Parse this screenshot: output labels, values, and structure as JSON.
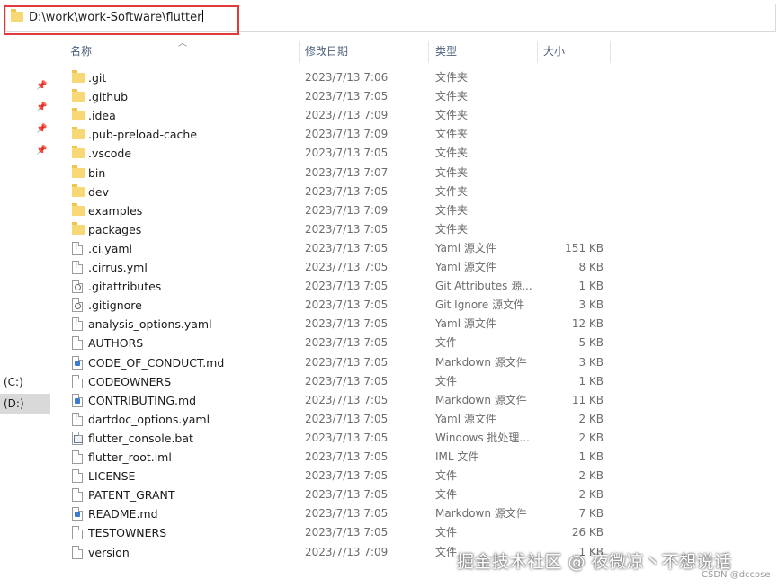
{
  "address_bar": {
    "path": "D:\\work\\work-Software\\flutter"
  },
  "columns": {
    "name": "名称",
    "modified": "修改日期",
    "type": "类型",
    "size": "大小"
  },
  "nav": {
    "drives": [
      {
        "label": "(C:)"
      },
      {
        "label": "(D:)"
      }
    ]
  },
  "files": [
    {
      "name": ".git",
      "modified": "2023/7/13 7:06",
      "type": "文件夹",
      "size": "",
      "icon": "folder-icon"
    },
    {
      "name": ".github",
      "modified": "2023/7/13 7:05",
      "type": "文件夹",
      "size": "",
      "icon": "folder-icon"
    },
    {
      "name": ".idea",
      "modified": "2023/7/13 7:09",
      "type": "文件夹",
      "size": "",
      "icon": "folder-icon"
    },
    {
      "name": ".pub-preload-cache",
      "modified": "2023/7/13 7:09",
      "type": "文件夹",
      "size": "",
      "icon": "folder-icon"
    },
    {
      "name": ".vscode",
      "modified": "2023/7/13 7:05",
      "type": "文件夹",
      "size": "",
      "icon": "folder-icon"
    },
    {
      "name": "bin",
      "modified": "2023/7/13 7:07",
      "type": "文件夹",
      "size": "",
      "icon": "folder-icon"
    },
    {
      "name": "dev",
      "modified": "2023/7/13 7:05",
      "type": "文件夹",
      "size": "",
      "icon": "folder-icon"
    },
    {
      "name": "examples",
      "modified": "2023/7/13 7:09",
      "type": "文件夹",
      "size": "",
      "icon": "folder-icon"
    },
    {
      "name": "packages",
      "modified": "2023/7/13 7:05",
      "type": "文件夹",
      "size": "",
      "icon": "folder-icon"
    },
    {
      "name": ".ci.yaml",
      "modified": "2023/7/13 7:05",
      "type": "Yaml 源文件",
      "size": "151 KB",
      "icon": "yaml-file-icon"
    },
    {
      "name": ".cirrus.yml",
      "modified": "2023/7/13 7:05",
      "type": "Yaml 源文件",
      "size": "8 KB",
      "icon": "yaml-file-icon"
    },
    {
      "name": ".gitattributes",
      "modified": "2023/7/13 7:05",
      "type": "Git Attributes 源...",
      "size": "1 KB",
      "icon": "gear-file-icon"
    },
    {
      "name": ".gitignore",
      "modified": "2023/7/13 7:05",
      "type": "Git Ignore 源文件",
      "size": "3 KB",
      "icon": "gear-file-icon"
    },
    {
      "name": "analysis_options.yaml",
      "modified": "2023/7/13 7:05",
      "type": "Yaml 源文件",
      "size": "12 KB",
      "icon": "yaml-file-icon"
    },
    {
      "name": "AUTHORS",
      "modified": "2023/7/13 7:05",
      "type": "文件",
      "size": "5 KB",
      "icon": "file-icon"
    },
    {
      "name": "CODE_OF_CONDUCT.md",
      "modified": "2023/7/13 7:05",
      "type": "Markdown 源文件",
      "size": "3 KB",
      "icon": "markdown-file-icon"
    },
    {
      "name": "CODEOWNERS",
      "modified": "2023/7/13 7:05",
      "type": "文件",
      "size": "1 KB",
      "icon": "file-icon"
    },
    {
      "name": "CONTRIBUTING.md",
      "modified": "2023/7/13 7:05",
      "type": "Markdown 源文件",
      "size": "11 KB",
      "icon": "markdown-file-icon"
    },
    {
      "name": "dartdoc_options.yaml",
      "modified": "2023/7/13 7:05",
      "type": "Yaml 源文件",
      "size": "2 KB",
      "icon": "yaml-file-icon"
    },
    {
      "name": "flutter_console.bat",
      "modified": "2023/7/13 7:05",
      "type": "Windows 批处理...",
      "size": "2 KB",
      "icon": "batch-file-icon"
    },
    {
      "name": "flutter_root.iml",
      "modified": "2023/7/13 7:05",
      "type": "IML 文件",
      "size": "1 KB",
      "icon": "file-icon"
    },
    {
      "name": "LICENSE",
      "modified": "2023/7/13 7:05",
      "type": "文件",
      "size": "2 KB",
      "icon": "file-icon"
    },
    {
      "name": "PATENT_GRANT",
      "modified": "2023/7/13 7:05",
      "type": "文件",
      "size": "2 KB",
      "icon": "file-icon"
    },
    {
      "name": "README.md",
      "modified": "2023/7/13 7:05",
      "type": "Markdown 源文件",
      "size": "7 KB",
      "icon": "markdown-file-icon"
    },
    {
      "name": "TESTOWNERS",
      "modified": "2023/7/13 7:05",
      "type": "文件",
      "size": "26 KB",
      "icon": "file-icon"
    },
    {
      "name": "version",
      "modified": "2023/7/13 7:09",
      "type": "文件",
      "size": "1 KB",
      "icon": "file-icon"
    }
  ],
  "watermark": {
    "main": "掘金技术社区 @ 夜微凉丶不想说话",
    "sub": "CSDN @dccose"
  },
  "colors": {
    "highlight_border": "#e03a3a",
    "folder": "#f8d775",
    "selected_drive_bg": "#d9d9d9"
  }
}
